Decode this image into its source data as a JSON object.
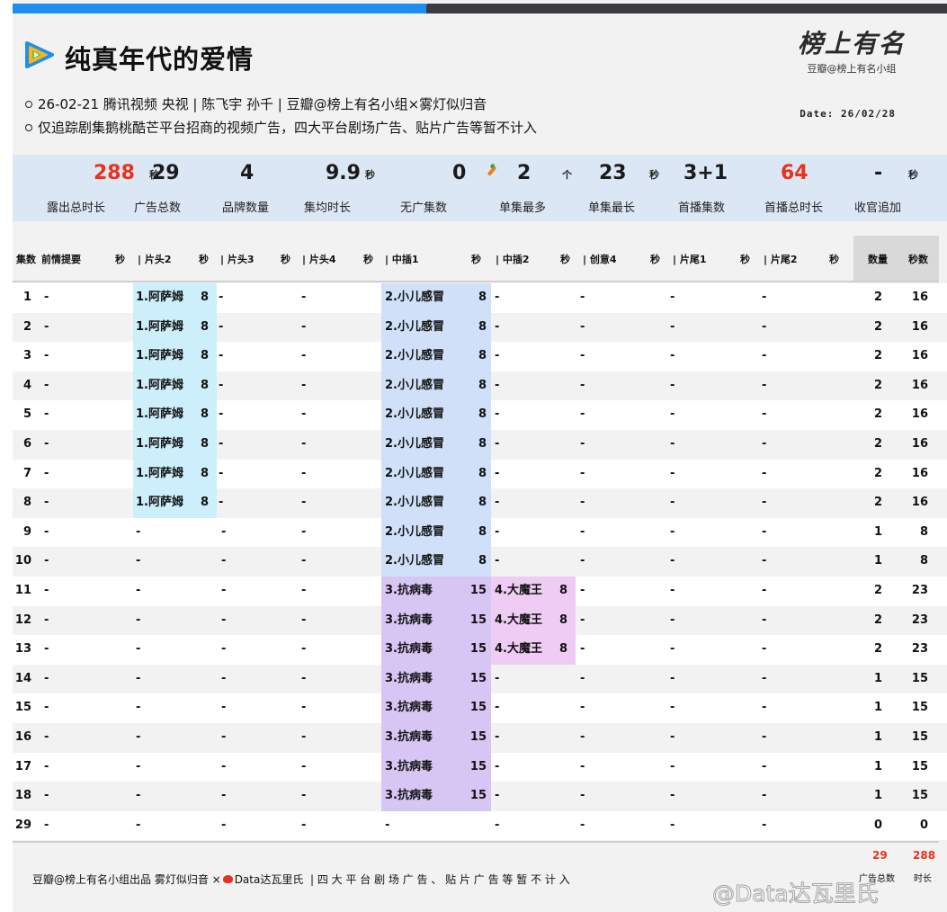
{
  "header": {
    "title": "纯真年代的爱情",
    "info_line1": "26-02-21 腾讯视频 央视 | 陈飞宇 孙千 | 豆瓣@榜上有名小组×雾灯似归音",
    "info_line2": "仅追踪剧集鹅桃酷芒平台招商的视频广告，四大平台剧场广告、贴片广告等暂不计入",
    "brand_script": "榜上有名",
    "brand_sub": "豆瓣@榜上有名小组",
    "date": "Date: 26/02/28"
  },
  "colors": {
    "accent_blue": "#1e8ff0",
    "highlight_red": "#e8321c",
    "band_preroll2": "#cdeefb",
    "band_mid1_a": "#cfe0f8",
    "band_mid1_b": "#d7c6f4",
    "band_mid2": "#efccf3"
  },
  "stats": [
    {
      "value": "288",
      "unit": "秒",
      "label": "露出总时长",
      "highlight": true
    },
    {
      "value": "29",
      "unit": "",
      "label": "广告总数",
      "highlight": false
    },
    {
      "value": "4",
      "unit": "",
      "label": "品牌数量",
      "highlight": false
    },
    {
      "value": "9.9",
      "unit": "秒",
      "label": "集均时长",
      "highlight": false
    },
    {
      "value": "0",
      "unit": "",
      "label": "无广集数",
      "highlight": false
    },
    {
      "value": "2",
      "unit": "个",
      "label": "单集最多",
      "highlight": false
    },
    {
      "value": "23",
      "unit": "秒",
      "label": "单集最长",
      "highlight": false
    },
    {
      "value": "3+1",
      "unit": "",
      "label": "首播集数",
      "highlight": false
    },
    {
      "value": "64",
      "unit": "",
      "label": "首播总时长",
      "highlight": true
    },
    {
      "value": "-",
      "unit": "秒",
      "label": "收官追加",
      "highlight": false
    }
  ],
  "columns": {
    "ep": "集数",
    "recap": "前情提要",
    "recap_s": "秒",
    "pre2": "| 片头2",
    "pre2_s": "秒",
    "pre3": "| 片头3",
    "pre3_s": "秒",
    "pre4": "| 片头4",
    "pre4_s": "秒",
    "mid1": "| 中插1",
    "mid1_s": "秒",
    "mid2": "| 中插2",
    "mid2_s": "秒",
    "cre4": "| 创意4",
    "cre4_s": "秒",
    "end1": "| 片尾1",
    "end1_s": "秒",
    "end2": "| 片尾2",
    "end2_s": "秒",
    "count": "数量",
    "secs": "秒数"
  },
  "chart_data": {
    "type": "table",
    "episodes": [
      {
        "ep": "1",
        "recap": "-",
        "pre2": "1.阿萨姆",
        "pre2_s": "8",
        "pre3": "-",
        "pre4": "-",
        "mid1": "2.小儿感冒",
        "mid1_s": "8",
        "mid2": "-",
        "mid2_s": "",
        "cre4": "-",
        "end1": "-",
        "end2": "-",
        "count": "2",
        "secs": "16"
      },
      {
        "ep": "2",
        "recap": "-",
        "pre2": "1.阿萨姆",
        "pre2_s": "8",
        "pre3": "-",
        "pre4": "-",
        "mid1": "2.小儿感冒",
        "mid1_s": "8",
        "mid2": "-",
        "mid2_s": "",
        "cre4": "-",
        "end1": "-",
        "end2": "-",
        "count": "2",
        "secs": "16"
      },
      {
        "ep": "3",
        "recap": "-",
        "pre2": "1.阿萨姆",
        "pre2_s": "8",
        "pre3": "-",
        "pre4": "-",
        "mid1": "2.小儿感冒",
        "mid1_s": "8",
        "mid2": "-",
        "mid2_s": "",
        "cre4": "-",
        "end1": "-",
        "end2": "-",
        "count": "2",
        "secs": "16"
      },
      {
        "ep": "4",
        "recap": "-",
        "pre2": "1.阿萨姆",
        "pre2_s": "8",
        "pre3": "-",
        "pre4": "-",
        "mid1": "2.小儿感冒",
        "mid1_s": "8",
        "mid2": "-",
        "mid2_s": "",
        "cre4": "-",
        "end1": "-",
        "end2": "-",
        "count": "2",
        "secs": "16"
      },
      {
        "ep": "5",
        "recap": "-",
        "pre2": "1.阿萨姆",
        "pre2_s": "8",
        "pre3": "-",
        "pre4": "-",
        "mid1": "2.小儿感冒",
        "mid1_s": "8",
        "mid2": "-",
        "mid2_s": "",
        "cre4": "-",
        "end1": "-",
        "end2": "-",
        "count": "2",
        "secs": "16"
      },
      {
        "ep": "6",
        "recap": "-",
        "pre2": "1.阿萨姆",
        "pre2_s": "8",
        "pre3": "-",
        "pre4": "-",
        "mid1": "2.小儿感冒",
        "mid1_s": "8",
        "mid2": "-",
        "mid2_s": "",
        "cre4": "-",
        "end1": "-",
        "end2": "-",
        "count": "2",
        "secs": "16"
      },
      {
        "ep": "7",
        "recap": "-",
        "pre2": "1.阿萨姆",
        "pre2_s": "8",
        "pre3": "-",
        "pre4": "-",
        "mid1": "2.小儿感冒",
        "mid1_s": "8",
        "mid2": "-",
        "mid2_s": "",
        "cre4": "-",
        "end1": "-",
        "end2": "-",
        "count": "2",
        "secs": "16"
      },
      {
        "ep": "8",
        "recap": "-",
        "pre2": "1.阿萨姆",
        "pre2_s": "8",
        "pre3": "-",
        "pre4": "-",
        "mid1": "2.小儿感冒",
        "mid1_s": "8",
        "mid2": "-",
        "mid2_s": "",
        "cre4": "-",
        "end1": "-",
        "end2": "-",
        "count": "2",
        "secs": "16"
      },
      {
        "ep": "9",
        "recap": "-",
        "pre2": "-",
        "pre2_s": "",
        "pre3": "-",
        "pre4": "-",
        "mid1": "2.小儿感冒",
        "mid1_s": "8",
        "mid2": "-",
        "mid2_s": "",
        "cre4": "-",
        "end1": "-",
        "end2": "-",
        "count": "1",
        "secs": "8"
      },
      {
        "ep": "10",
        "recap": "-",
        "pre2": "-",
        "pre2_s": "",
        "pre3": "-",
        "pre4": "-",
        "mid1": "2.小儿感冒",
        "mid1_s": "8",
        "mid2": "-",
        "mid2_s": "",
        "cre4": "-",
        "end1": "-",
        "end2": "-",
        "count": "1",
        "secs": "8"
      },
      {
        "ep": "11",
        "recap": "-",
        "pre2": "-",
        "pre2_s": "",
        "pre3": "-",
        "pre4": "-",
        "mid1": "3.抗病毒",
        "mid1_s": "15",
        "mid2": "4.大魔王",
        "mid2_s": "8",
        "cre4": "-",
        "end1": "-",
        "end2": "-",
        "count": "2",
        "secs": "23"
      },
      {
        "ep": "12",
        "recap": "-",
        "pre2": "-",
        "pre2_s": "",
        "pre3": "-",
        "pre4": "-",
        "mid1": "3.抗病毒",
        "mid1_s": "15",
        "mid2": "4.大魔王",
        "mid2_s": "8",
        "cre4": "-",
        "end1": "-",
        "end2": "-",
        "count": "2",
        "secs": "23"
      },
      {
        "ep": "13",
        "recap": "-",
        "pre2": "-",
        "pre2_s": "",
        "pre3": "-",
        "pre4": "-",
        "mid1": "3.抗病毒",
        "mid1_s": "15",
        "mid2": "4.大魔王",
        "mid2_s": "8",
        "cre4": "-",
        "end1": "-",
        "end2": "-",
        "count": "2",
        "secs": "23"
      },
      {
        "ep": "14",
        "recap": "-",
        "pre2": "-",
        "pre2_s": "",
        "pre3": "-",
        "pre4": "-",
        "mid1": "3.抗病毒",
        "mid1_s": "15",
        "mid2": "-",
        "mid2_s": "",
        "cre4": "-",
        "end1": "-",
        "end2": "-",
        "count": "1",
        "secs": "15"
      },
      {
        "ep": "15",
        "recap": "-",
        "pre2": "-",
        "pre2_s": "",
        "pre3": "-",
        "pre4": "-",
        "mid1": "3.抗病毒",
        "mid1_s": "15",
        "mid2": "-",
        "mid2_s": "",
        "cre4": "-",
        "end1": "-",
        "end2": "-",
        "count": "1",
        "secs": "15"
      },
      {
        "ep": "16",
        "recap": "-",
        "pre2": "-",
        "pre2_s": "",
        "pre3": "-",
        "pre4": "-",
        "mid1": "3.抗病毒",
        "mid1_s": "15",
        "mid2": "-",
        "mid2_s": "",
        "cre4": "-",
        "end1": "-",
        "end2": "-",
        "count": "1",
        "secs": "15"
      },
      {
        "ep": "17",
        "recap": "-",
        "pre2": "-",
        "pre2_s": "",
        "pre3": "-",
        "pre4": "-",
        "mid1": "3.抗病毒",
        "mid1_s": "15",
        "mid2": "-",
        "mid2_s": "",
        "cre4": "-",
        "end1": "-",
        "end2": "-",
        "count": "1",
        "secs": "15"
      },
      {
        "ep": "18",
        "recap": "-",
        "pre2": "-",
        "pre2_s": "",
        "pre3": "-",
        "pre4": "-",
        "mid1": "3.抗病毒",
        "mid1_s": "15",
        "mid2": "-",
        "mid2_s": "",
        "cre4": "-",
        "end1": "-",
        "end2": "-",
        "count": "1",
        "secs": "15"
      },
      {
        "ep": "29",
        "recap": "-",
        "pre2": "-",
        "pre2_s": "",
        "pre3": "-",
        "pre4": "-",
        "mid1": "-",
        "mid1_s": "",
        "mid2": "-",
        "mid2_s": "",
        "cre4": "-",
        "end1": "-",
        "end2": "-",
        "count": "0",
        "secs": "0"
      }
    ]
  },
  "totals": {
    "count": "29",
    "secs": "288",
    "count_label": "广告总数",
    "secs_label": "时长"
  },
  "footer": {
    "credit": "豆瓣@榜上有名小组出品  雾灯似归音 ×",
    "credit2": "Data达瓦里氏",
    "note": "|  四 大 平 台 剧 场 广 告 、 贴 片 广 告 等 暂 不 计 入",
    "watermark": "@Data达瓦里氏"
  }
}
